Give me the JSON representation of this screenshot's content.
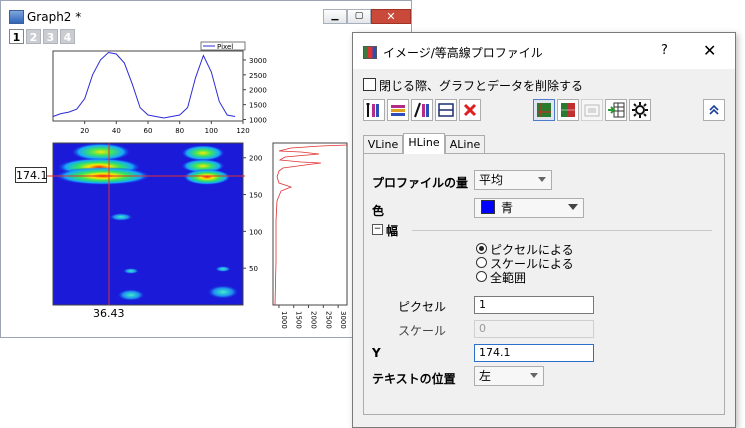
{
  "graph_window": {
    "title": "Graph2 *",
    "layer_tabs": [
      "1",
      "2",
      "3",
      "4"
    ],
    "active_layer": "1",
    "legend_text": "Pixel",
    "cursor_x_value": "36.43",
    "cursor_y_value": "174.1",
    "colors": {
      "profile_line": "#2b2bd6",
      "vertical_profile": "#e03030",
      "cursor": "#e03030",
      "image_bg": "#1a1ad8"
    },
    "chart_data": [
      {
        "type": "line",
        "name": "horizontal profile",
        "x": [
          0,
          5,
          10,
          15,
          20,
          25,
          30,
          35,
          40,
          45,
          50,
          55,
          60,
          65,
          70,
          75,
          80,
          85,
          90,
          95,
          100,
          105,
          110,
          115
        ],
        "values": [
          1100,
          1200,
          1250,
          1350,
          1700,
          2500,
          3000,
          3250,
          3200,
          2900,
          2200,
          1400,
          1150,
          1100,
          1050,
          1100,
          1150,
          1400,
          2400,
          3150,
          2600,
          1600,
          1150,
          1100
        ],
        "xticks": [
          "20",
          "40",
          "60",
          "80",
          "100",
          "120"
        ],
        "yticks": [
          "1000",
          "1500",
          "2000",
          "2500",
          "3000"
        ],
        "xlim": [
          0,
          120
        ],
        "ylim": [
          950,
          3300
        ]
      },
      {
        "type": "heatmap",
        "name": "image",
        "yticks": [
          "200",
          "150",
          "100",
          "50"
        ],
        "ylim": [
          0,
          220
        ],
        "xlim": [
          0,
          120
        ]
      },
      {
        "type": "line",
        "name": "vertical profile",
        "xticks": [
          "1000",
          "1500",
          "2000",
          "2500",
          "3000"
        ],
        "xlim": [
          800,
          3300
        ]
      }
    ]
  },
  "dialog": {
    "title": "イメージ/等高線プロファイル",
    "help_label": "?",
    "close_label": "✕",
    "delete_checkbox_label": "閉じる際、グラフとデータを削除する",
    "delete_checked": false,
    "toolbar_icons": [
      "add-vertical-line-icon",
      "add-horizontal-line-icon",
      "add-arbitrary-line-icon",
      "remove-line-icon",
      "delete-icon",
      "image-profile-icon",
      "color-map-icon",
      "image-snapshot-icon",
      "export-data-icon",
      "settings-icon",
      "collapse-icon"
    ],
    "tabs": [
      "VLine",
      "HLine",
      "ALine"
    ],
    "active_tab": "HLine",
    "profile_amount_label": "プロファイルの量",
    "profile_amount_value": "平均",
    "color_label": "色",
    "color_value": "青",
    "color_swatch": "#0000ff",
    "width_section_label": "幅",
    "radio_pixel": "ピクセルによる",
    "radio_scale": "スケールによる",
    "radio_all": "全範囲",
    "radio_selected": "pixel",
    "pixel_label": "ピクセル",
    "pixel_value": "1",
    "scale_label": "スケール",
    "scale_value": "0",
    "y_label": "Y",
    "y_value": "174.1",
    "text_pos_label": "テキストの位置",
    "text_pos_value": "左"
  }
}
